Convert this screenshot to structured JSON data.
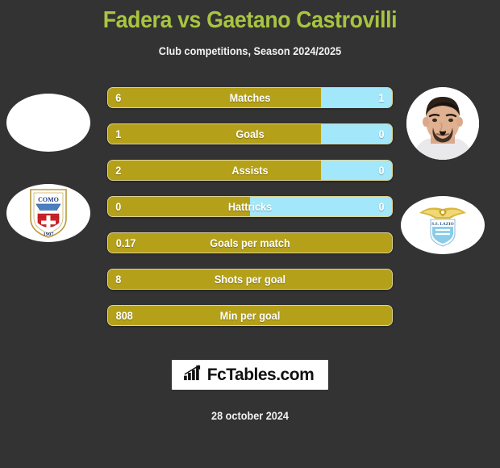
{
  "header": {
    "title": "Fadera vs Gaetano Castrovilli",
    "subtitle": "Club competitions, Season 2024/2025",
    "title_color": "#a8c440"
  },
  "colors": {
    "background": "#333333",
    "home_bar": "#b5a119",
    "away_bar": "#a3e7fb",
    "text": "#ffffff"
  },
  "left_player": {
    "photo_alt": "player-photo-placeholder",
    "club_crest_name": "Como 1907",
    "crest_text_top": "COMO",
    "crest_text_bottom": "1907"
  },
  "right_player": {
    "photo_alt": "Gaetano Castrovilli",
    "club_crest_name": "S.S. Lazio",
    "crest_text": "S.S. LAZIO"
  },
  "stats": [
    {
      "label": "Matches",
      "left": "6",
      "right": "1",
      "left_pct": 75,
      "split": true
    },
    {
      "label": "Goals",
      "left": "1",
      "right": "0",
      "left_pct": 75,
      "split": true
    },
    {
      "label": "Assists",
      "left": "2",
      "right": "0",
      "left_pct": 75,
      "split": true
    },
    {
      "label": "Hattricks",
      "left": "0",
      "right": "0",
      "left_pct": 50,
      "split": true
    },
    {
      "label": "Goals per match",
      "left": "0.17",
      "right": "",
      "left_pct": 100,
      "split": false
    },
    {
      "label": "Shots per goal",
      "left": "8",
      "right": "",
      "left_pct": 100,
      "split": false
    },
    {
      "label": "Min per goal",
      "left": "808",
      "right": "",
      "left_pct": 100,
      "split": false
    }
  ],
  "footer": {
    "logo_text": "FcTables.com",
    "logo_icon": "bar-chart-arrow-icon",
    "date": "28 october 2024"
  }
}
